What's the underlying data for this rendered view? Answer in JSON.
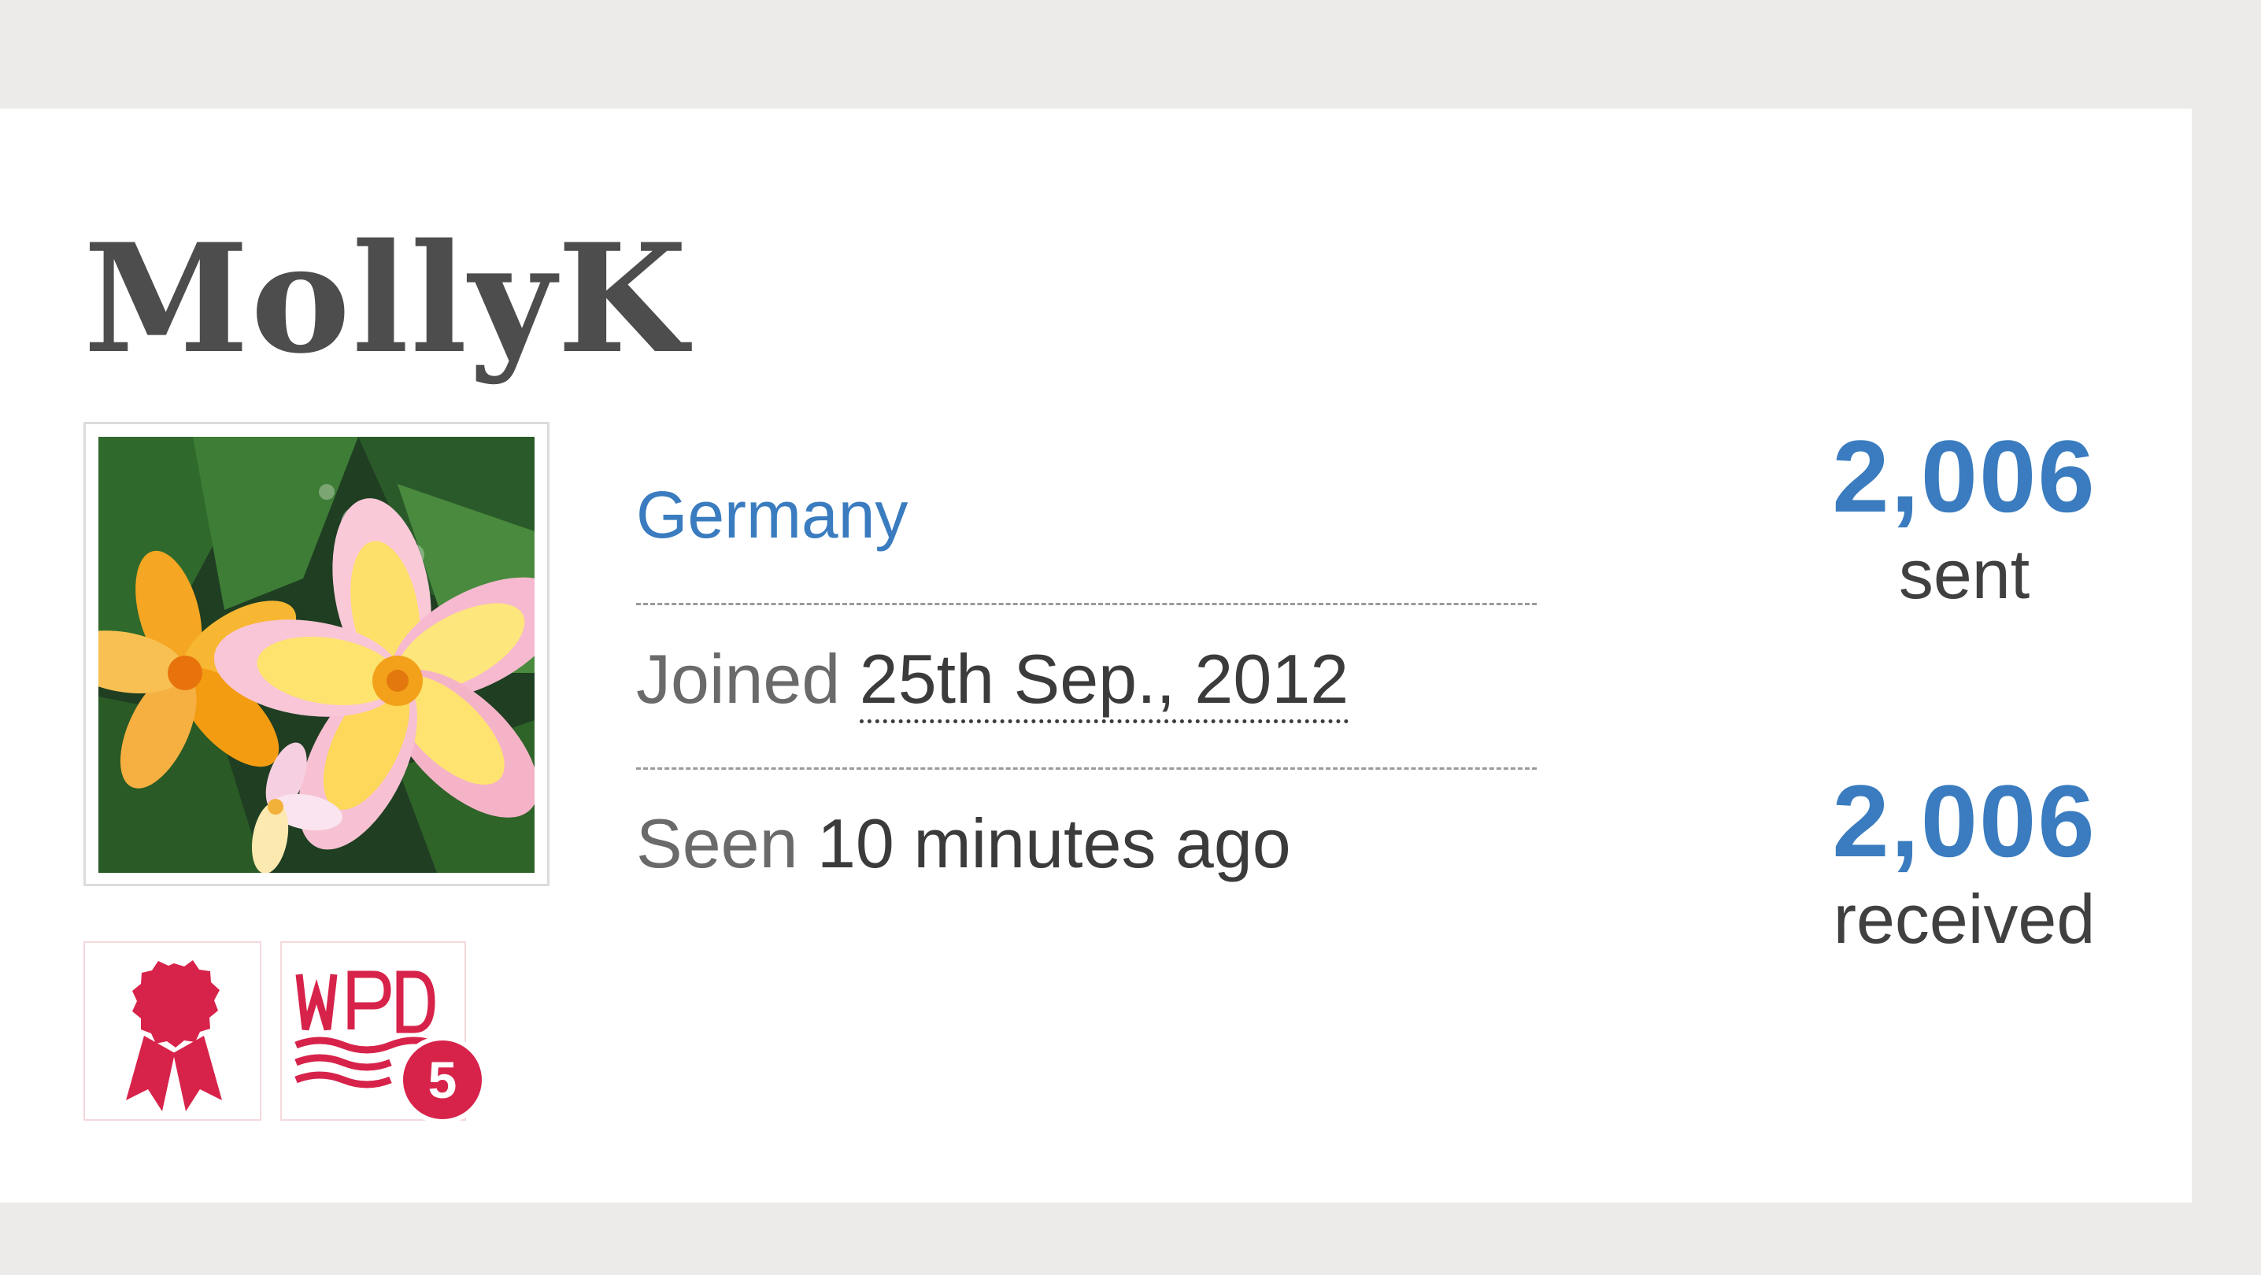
{
  "profile": {
    "username": "MollyK",
    "country": "Germany",
    "joined_label": "Joined",
    "joined_date": "25th Sep., 2012",
    "seen_label": "Seen",
    "seen_value": "10 minutes ago"
  },
  "stats": {
    "sent_count": "2,006",
    "sent_label": "sent",
    "received_count": "2,006",
    "received_label": "received"
  },
  "badges": [
    {
      "icon": "ribbon-award-icon"
    },
    {
      "icon": "wpd-badge-icon",
      "text": "WPD",
      "count": "5"
    }
  ],
  "colors": {
    "link_blue": "#3a7cbf",
    "badge_red": "#d7234a",
    "page_bg": "#ecebea",
    "card_bg": "#ffffff"
  }
}
